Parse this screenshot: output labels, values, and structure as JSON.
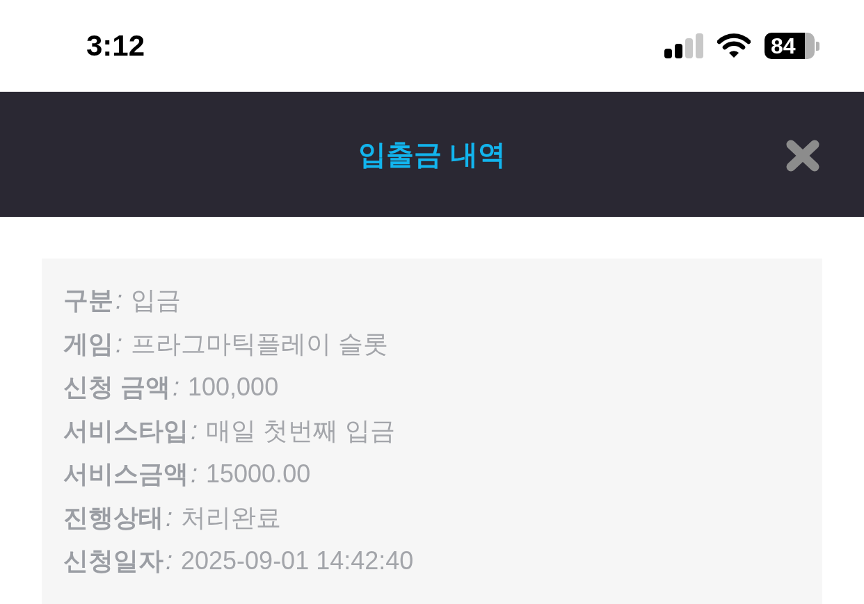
{
  "status_bar": {
    "time": "3:12",
    "battery": "84"
  },
  "header": {
    "title": "입출금 내역"
  },
  "details": [
    {
      "label": "구분",
      "separator": ":",
      "value": "입금"
    },
    {
      "label": "게임",
      "separator": ":",
      "value": "프라그마틱플레이 슬롯"
    },
    {
      "label": "신청 금액",
      "separator": ":",
      "value": "100,000"
    },
    {
      "label": "서비스타입",
      "separator": ":",
      "value": "매일 첫번째 입금"
    },
    {
      "label": "서비스금액",
      "separator": ":",
      "value": "15000.00"
    },
    {
      "label": "진행상태",
      "separator": ":",
      "value": "처리완료"
    },
    {
      "label": "신청일자",
      "separator": ":",
      "value": "2025-09-01 14:42:40"
    }
  ]
}
